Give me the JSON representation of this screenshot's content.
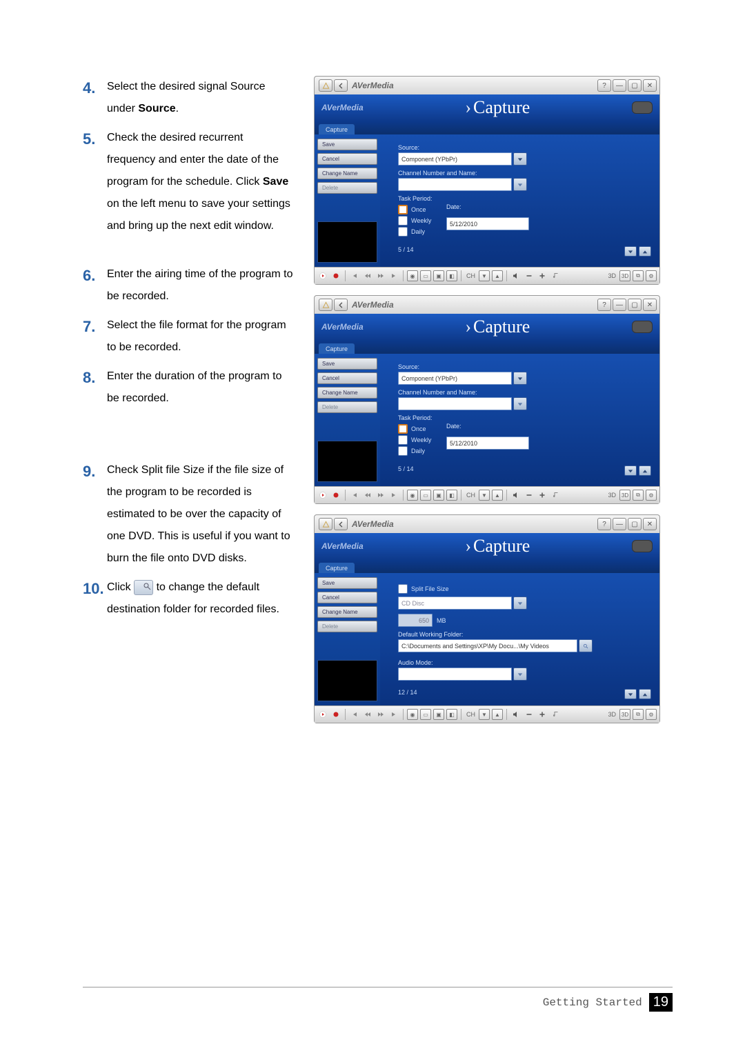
{
  "steps": {
    "s4": {
      "num": "4.",
      "text_a": "Select the desired signal Source under ",
      "bold": "Source",
      "text_b": "."
    },
    "s5": {
      "num": "5.",
      "text_a": "Check the desired recurrent frequency and enter the date of the program for the schedule. Click ",
      "bold": "Save",
      "text_b": " on the left menu to save your settings and bring up the next edit window."
    },
    "s6": {
      "num": "6.",
      "text": "Enter the airing time of the program to be recorded."
    },
    "s7": {
      "num": "7.",
      "text": "Select the file format for the program to be recorded."
    },
    "s8": {
      "num": "8.",
      "text": "Enter the duration of the program to be recorded."
    },
    "s9": {
      "num": "9.",
      "text": "Check Split file Size if the file size of the program to be recorded is estimated to be over the capacity of one DVD. This is useful if you want to burn the file onto DVD disks."
    },
    "s10": {
      "num": "10.",
      "text_a": "Click ",
      "text_b": " to change the default destination folder for recorded files."
    }
  },
  "shot_common": {
    "brand": "AVerMedia",
    "title": "Capture",
    "tab": "Capture",
    "side": {
      "save": "Save",
      "cancel": "Cancel",
      "change": "Change Name",
      "delete": "Delete"
    },
    "source_label": "Source:",
    "source_value": "Component (YPbPr)",
    "chan_label": "Channel Number and Name:",
    "task_label": "Task Period:",
    "once": "Once",
    "weekly": "Weekly",
    "daily": "Daily",
    "date_label": "Date:",
    "date_value": "5/12/2010",
    "pager": "5 / 14",
    "ctrl": {
      "ch": "CH",
      "threeD": "3D"
    }
  },
  "shot3": {
    "split_label": "Split File Size",
    "disc": "CD Disc",
    "size": "650",
    "unit": "MB",
    "folder_label": "Default Working Folder:",
    "folder_value": "C:\\Documents and Settings\\XP\\My Docu...\\My Videos",
    "audio_label": "Audio Mode:",
    "pager": "12 / 14"
  },
  "footer": {
    "label": "Getting Started",
    "page": "19"
  }
}
